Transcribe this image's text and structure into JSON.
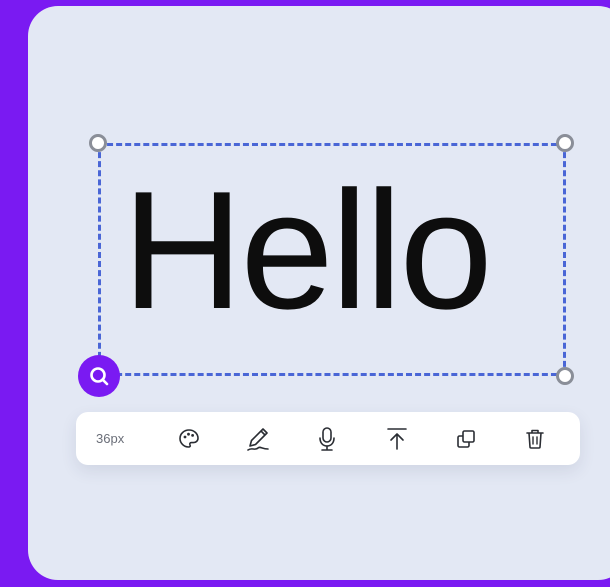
{
  "canvas": {
    "text_element": {
      "content": "Hello"
    }
  },
  "toolbar": {
    "font_size_label": "36px",
    "tools": [
      {
        "icon": "palette-icon"
      },
      {
        "icon": "pen-icon"
      },
      {
        "icon": "microphone-icon"
      },
      {
        "icon": "bring-to-front-icon"
      },
      {
        "icon": "duplicate-icon"
      },
      {
        "icon": "trash-icon"
      }
    ]
  },
  "colors": {
    "background": "#7a1af2",
    "card": "#e3e8f4",
    "selection_border": "#4a66d6",
    "text": "#0d0d0d",
    "accent": "#7a1af2"
  }
}
